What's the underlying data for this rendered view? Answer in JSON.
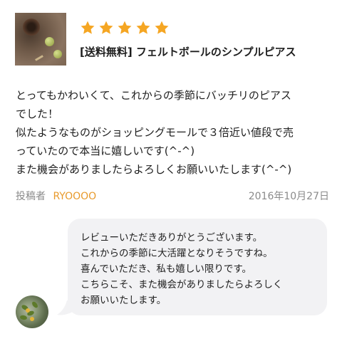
{
  "product": {
    "title": "[送料無料] フェルトボールのシンプルピアス",
    "rating": 5,
    "star_color": "#f5a623"
  },
  "review": {
    "lines": [
      "とってもかわいくて、これからの季節にバッチリのピアス",
      "でした！",
      "似たようなものがショッピングモールで３倍近い値段で売",
      "っていたので本当に嬉しいです(^-^)",
      "また機会がありましたらよろしくお願いいたします(^-^)"
    ],
    "poster_label": "投稿者",
    "poster_name": "RYOOOO",
    "poster_color": "#e89a2c",
    "date": "2016年10月27日"
  },
  "reply": {
    "lines": [
      "レビューいただきありがとうございます。",
      "これからの季節に大活躍となりそうですね。",
      "喜んでいただき、私も嬉しい限りです。",
      "こちらこそ、また機会がありましたらよろしく",
      "お願いいたします。"
    ],
    "bubble_color": "#f2f2f4"
  }
}
